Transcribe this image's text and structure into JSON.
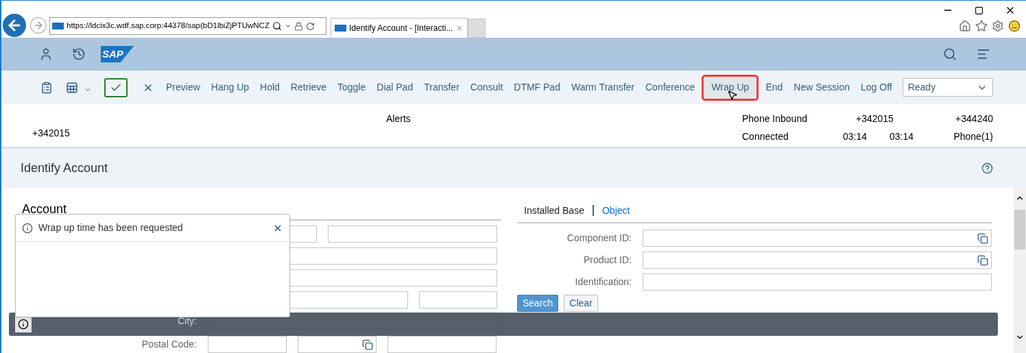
{
  "browser": {
    "url": "https://ldcix3c.wdf.sap.corp:44378/sap(bD1lbiZjPTUwNCZ",
    "tab_title": "Identify Account - [Interacti..."
  },
  "shell": {
    "logo_text": "SAP"
  },
  "toolbar": {
    "actions": [
      {
        "label": "Preview",
        "highlighted": false
      },
      {
        "label": "Hang Up",
        "highlighted": false
      },
      {
        "label": "Hold",
        "highlighted": false
      },
      {
        "label": "Retrieve",
        "highlighted": false
      },
      {
        "label": "Toggle",
        "highlighted": false
      },
      {
        "label": "Dial Pad",
        "highlighted": false
      },
      {
        "label": "Transfer",
        "highlighted": false
      },
      {
        "label": "Consult",
        "highlighted": false
      },
      {
        "label": "DTMF Pad",
        "highlighted": false
      },
      {
        "label": "Warm Transfer",
        "highlighted": false
      },
      {
        "label": "Conference",
        "highlighted": false
      },
      {
        "label": "Wrap Up",
        "highlighted": true
      },
      {
        "label": "End",
        "highlighted": false
      },
      {
        "label": "New Session",
        "highlighted": false
      },
      {
        "label": "Log Off",
        "highlighted": false
      }
    ],
    "status_select": {
      "value": "Ready"
    }
  },
  "call_info": {
    "alerts_label": "Alerts",
    "caller": "+342015",
    "channel_type": "Phone Inbound",
    "from_number": "+342015",
    "to_number": "+344240",
    "status": "Connected",
    "duration": "03:14",
    "talk_time": "03:14",
    "channel": "Phone(1)"
  },
  "page": {
    "title": "Identify Account"
  },
  "account": {
    "title": "Account",
    "fields": [
      {
        "label": "City:"
      },
      {
        "label": "Postal Code:"
      }
    ]
  },
  "installed_base": {
    "tabs": [
      {
        "label": "Installed Base",
        "selected": true
      },
      {
        "label": "Object",
        "selected": false
      }
    ],
    "fields": [
      {
        "label": "Component ID:",
        "value_help": true
      },
      {
        "label": "Product ID:",
        "value_help": true
      },
      {
        "label": "Identification:",
        "value_help": false
      }
    ],
    "buttons": [
      {
        "label": "Search",
        "kind": "primary"
      },
      {
        "label": "Clear",
        "kind": "secondary"
      }
    ]
  },
  "notification": {
    "message": "Wrap up time has been requested"
  }
}
